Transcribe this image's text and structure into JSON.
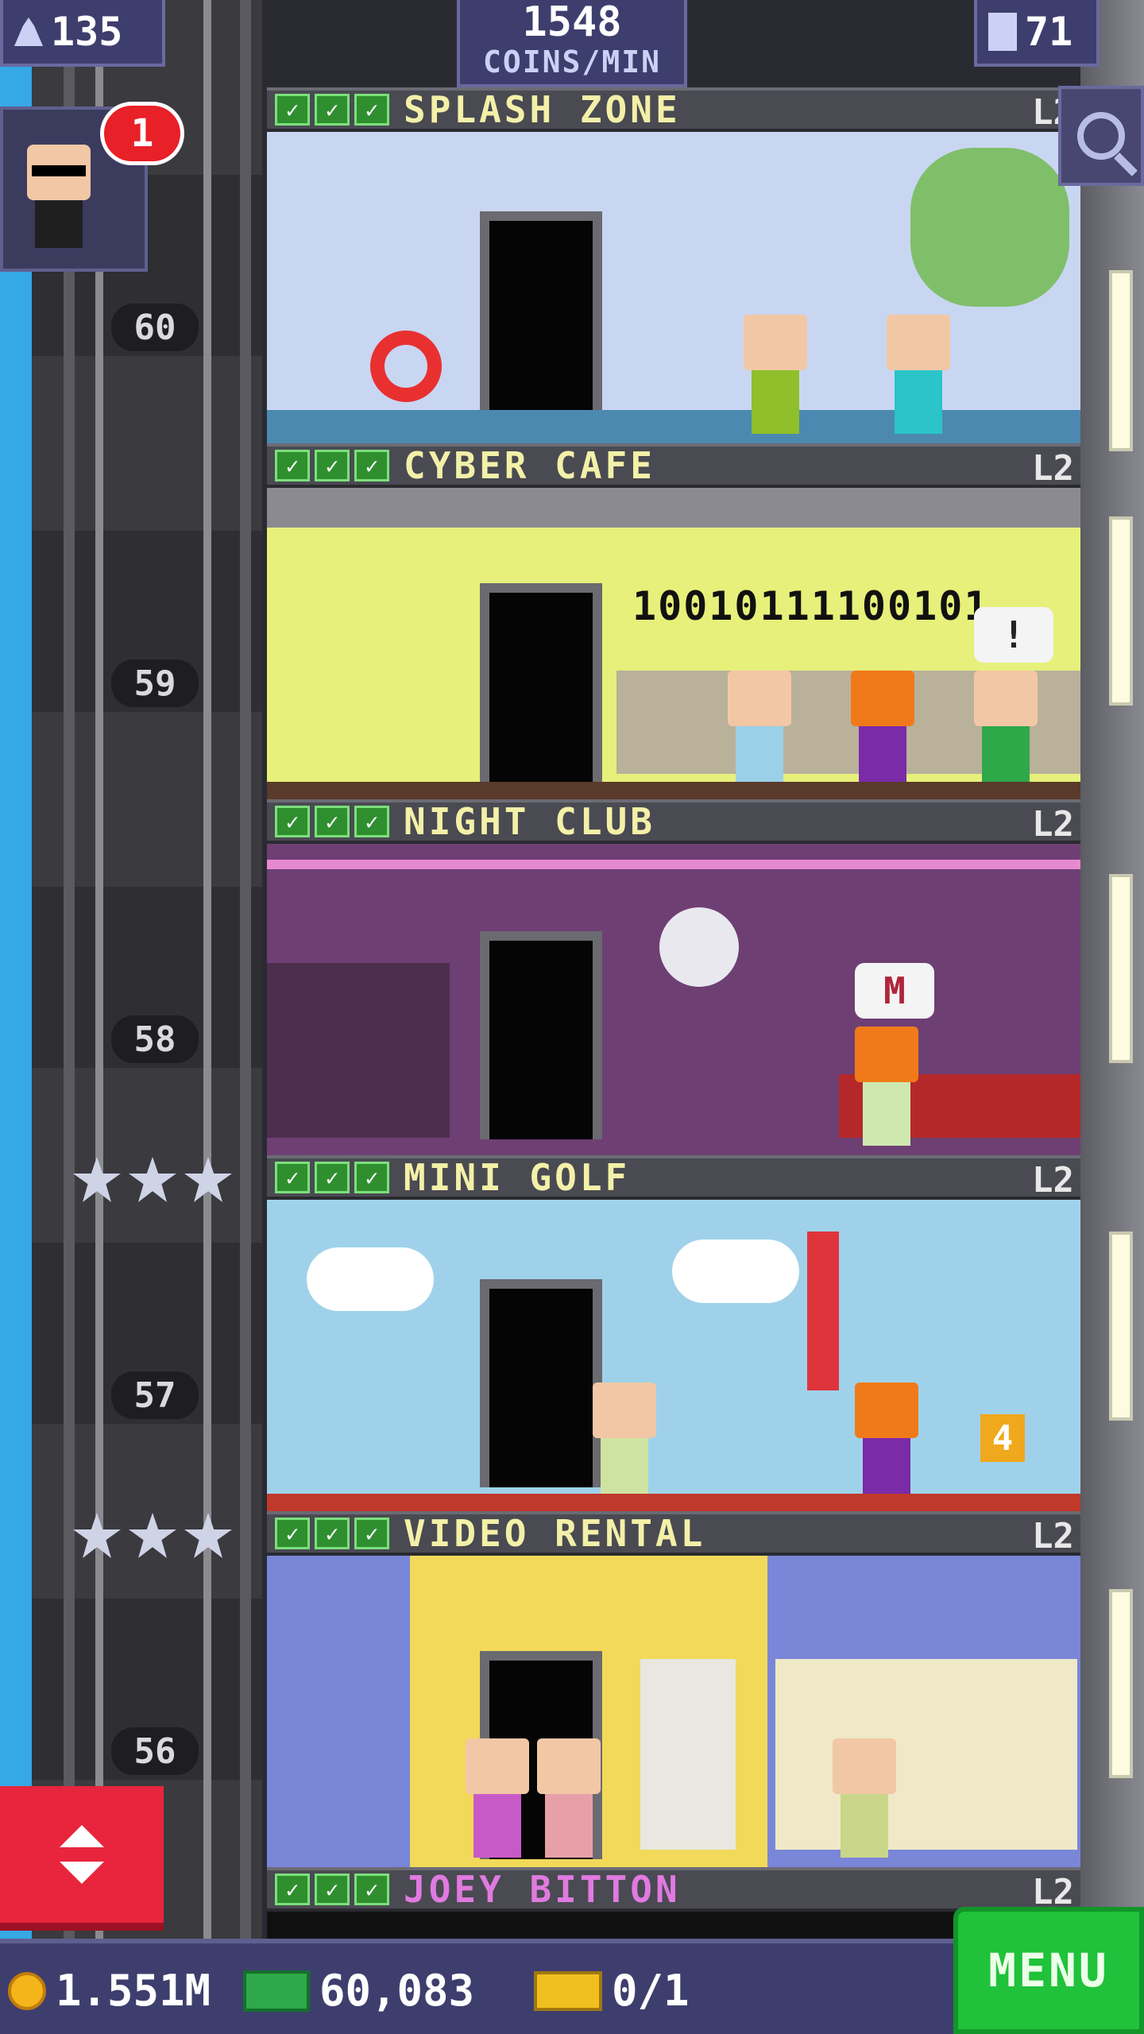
{
  "top_bar": {
    "population": "135",
    "coins_per_min_value": "1548",
    "coins_per_min_label": "COINS/MIN",
    "floors_count": "71"
  },
  "notifications": {
    "badge_count": "1"
  },
  "floors": [
    {
      "name": "SPLASH ZONE",
      "level": "L2",
      "floor_number": "60",
      "room_color": "#c9d6f2"
    },
    {
      "name": "CYBER CAFE",
      "level": "L2",
      "floor_number": "59",
      "room_color": "#e6f07a",
      "wall_text": "10010111100101"
    },
    {
      "name": "NIGHT CLUB",
      "level": "L2",
      "floor_number": "58",
      "room_color": "#6e3f73"
    },
    {
      "name": "MINI GOLF",
      "level": "L2",
      "floor_number": "57",
      "room_color": "#9fd2ea",
      "hole_sign": "4"
    },
    {
      "name": "VIDEO RENTAL",
      "level": "L2",
      "floor_number": "56",
      "room_color": "#f2d95a"
    },
    {
      "name": "JOEY BITTON",
      "level": "L2"
    }
  ],
  "speech_bubbles": {
    "cyber_alert": "!",
    "club_letter": "M"
  },
  "bottom_bar": {
    "coins": "1.551M",
    "bux": "60,083",
    "tickets": "0/1",
    "menu_label": "MENU"
  },
  "colors": {
    "accent_panel": "#3e3e6e",
    "menu_green": "#1fc23a",
    "elevator_red": "#e8253c",
    "floor_title": "#f3f0a8"
  },
  "icons": [
    "people-icon",
    "building-icon",
    "magnifier-icon",
    "coin-icon",
    "bux-icon",
    "ticket-icon",
    "arrow-up-icon",
    "arrow-down-icon",
    "check-icon",
    "star-icon"
  ]
}
